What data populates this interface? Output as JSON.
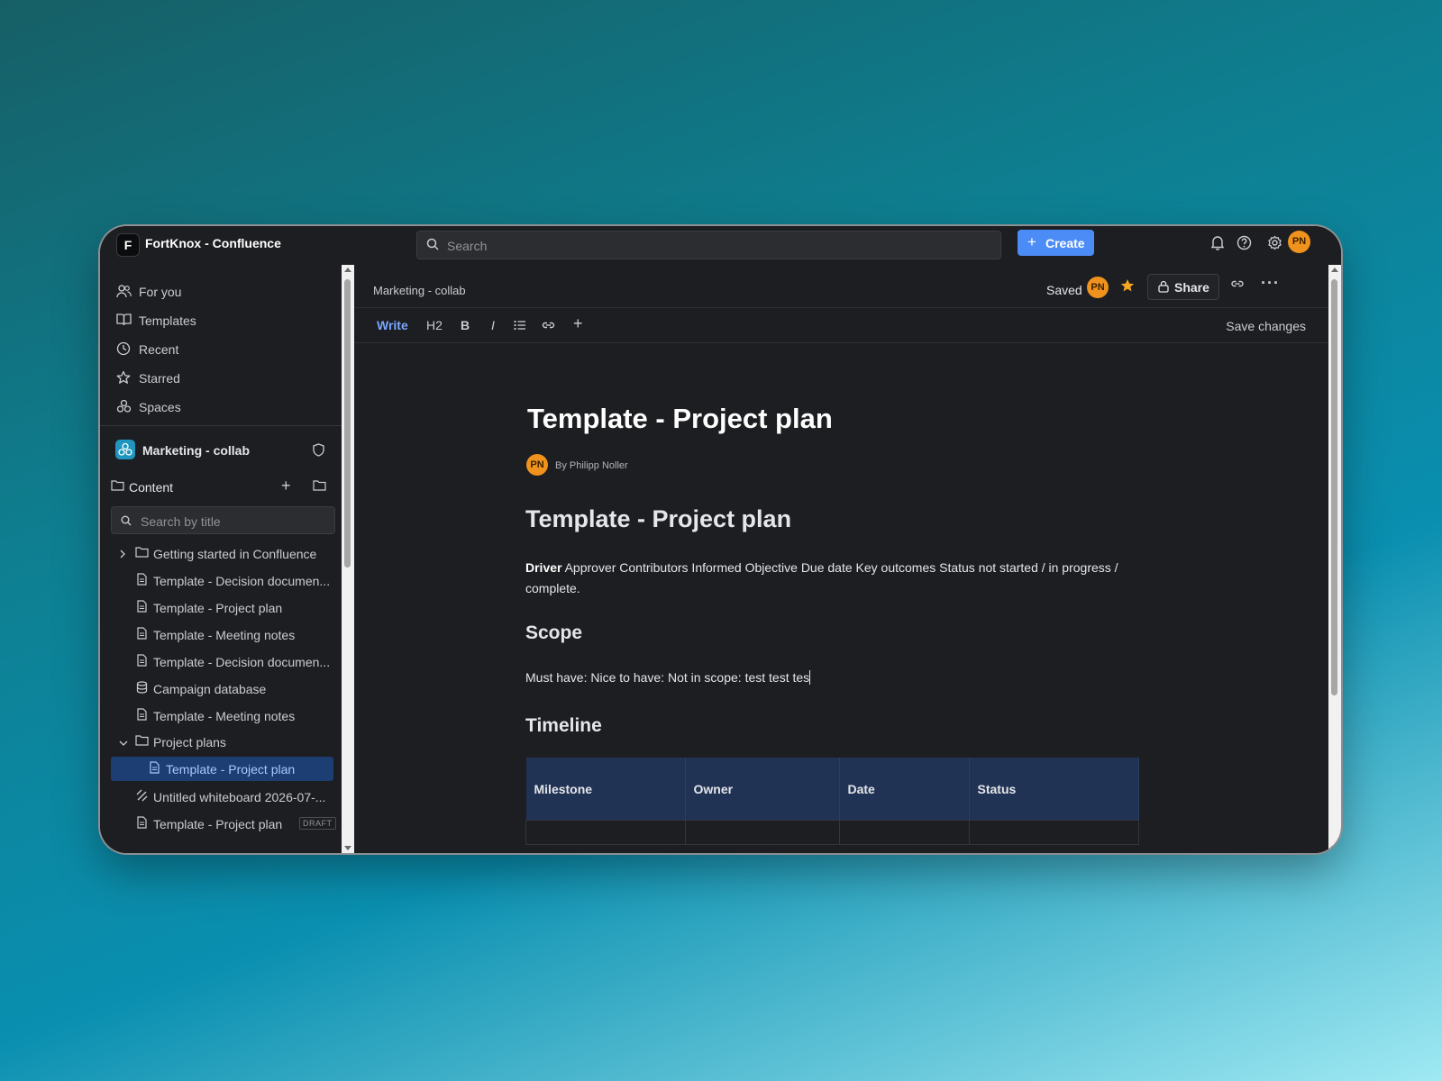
{
  "app": {
    "logo_letter": "F",
    "title": "FortKnox - Confluence"
  },
  "topbar": {
    "search_placeholder": "Search",
    "create_label": "Create",
    "user_initials": "PN",
    "accent_color": "#4c8cf6",
    "avatar_color": "#f0921e"
  },
  "sidebar": {
    "nav": [
      {
        "label": "For you",
        "icon": "people-icon"
      },
      {
        "label": "Templates",
        "icon": "book-icon"
      },
      {
        "label": "Recent",
        "icon": "clock-icon"
      },
      {
        "label": "Starred",
        "icon": "star-icon"
      },
      {
        "label": "Spaces",
        "icon": "spaces-icon"
      }
    ],
    "space_name": "Marketing - collab",
    "content_label": "Content",
    "title_search_placeholder": "Search by title",
    "tree": [
      {
        "label": "Getting started in Confluence",
        "icon": "folder-icon"
      },
      {
        "label": "Template - Decision documen...",
        "icon": "page-icon"
      },
      {
        "label": "Template - Project plan",
        "icon": "page-icon"
      },
      {
        "label": "Template - Meeting notes",
        "icon": "page-icon"
      },
      {
        "label": "Template - Decision documen...",
        "icon": "page-icon"
      },
      {
        "label": "Campaign database",
        "icon": "database-icon"
      },
      {
        "label": "Template - Meeting notes",
        "icon": "page-icon"
      },
      {
        "label": "Project plans",
        "icon": "folder-icon"
      },
      {
        "label": "Template - Project plan",
        "icon": "page-icon",
        "active": true
      },
      {
        "label": "Untitled whiteboard 2026-07-...",
        "icon": "whiteboard-icon"
      },
      {
        "label": "Template - Project plan",
        "icon": "page-icon",
        "badge": "DRAFT"
      }
    ]
  },
  "main": {
    "breadcrumb": "Marketing - collab",
    "saved_label": "Saved",
    "share_label": "Share",
    "toolbar": {
      "write": "Write",
      "h2": "H2",
      "bold": "B",
      "italic": "I",
      "save_changes": "Save changes"
    },
    "doc": {
      "title": "Template - Project plan",
      "author": "By Philipp Noller",
      "heading": "Template - Project plan",
      "para_bold": "Driver",
      "para_rest": " Approver Contributors Informed Objective Due date Key outcomes Status not started / in progress / complete.",
      "scope_heading": "Scope",
      "scope_text": "Must have: Nice to have: Not in scope: test test tes",
      "timeline_heading": "Timeline",
      "table_headers": [
        "Milestone",
        "Owner",
        "Date",
        "Status"
      ]
    }
  }
}
